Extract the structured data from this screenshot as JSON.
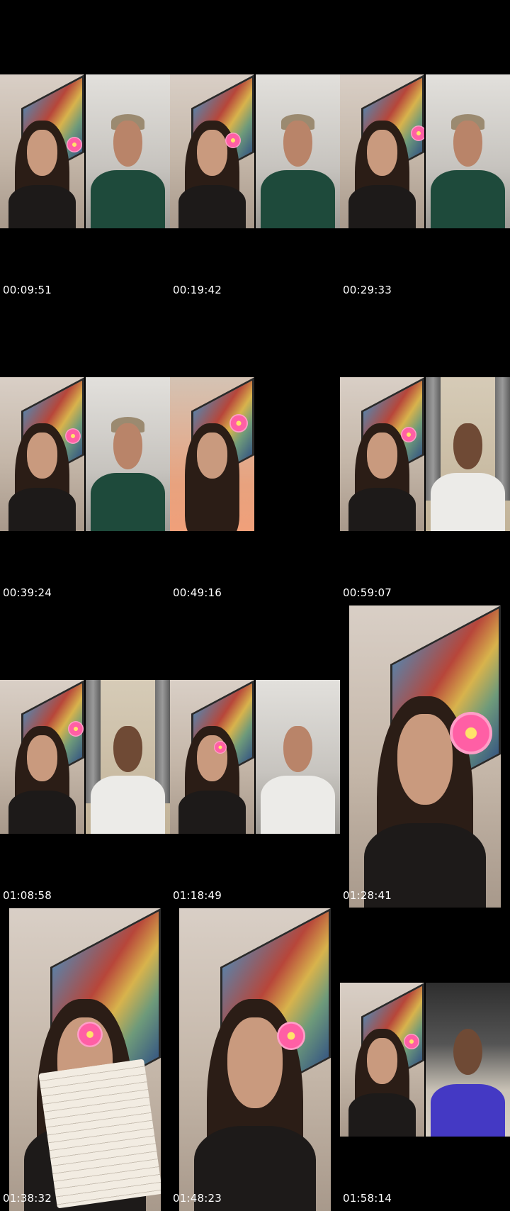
{
  "timestamps": [
    "00:09:51",
    "00:19:42",
    "00:29:33",
    "00:39:24",
    "00:49:16",
    "00:59:07",
    "01:08:58",
    "01:18:49",
    "01:28:41",
    "01:38:32",
    "01:48:23",
    "01:58:14"
  ],
  "icons": {
    "flower": "hibiscus-flower-icon"
  },
  "colors": {
    "background": "#000000",
    "timestamp_text": "#ffffff",
    "flower_pink": "#ff5fa5"
  }
}
